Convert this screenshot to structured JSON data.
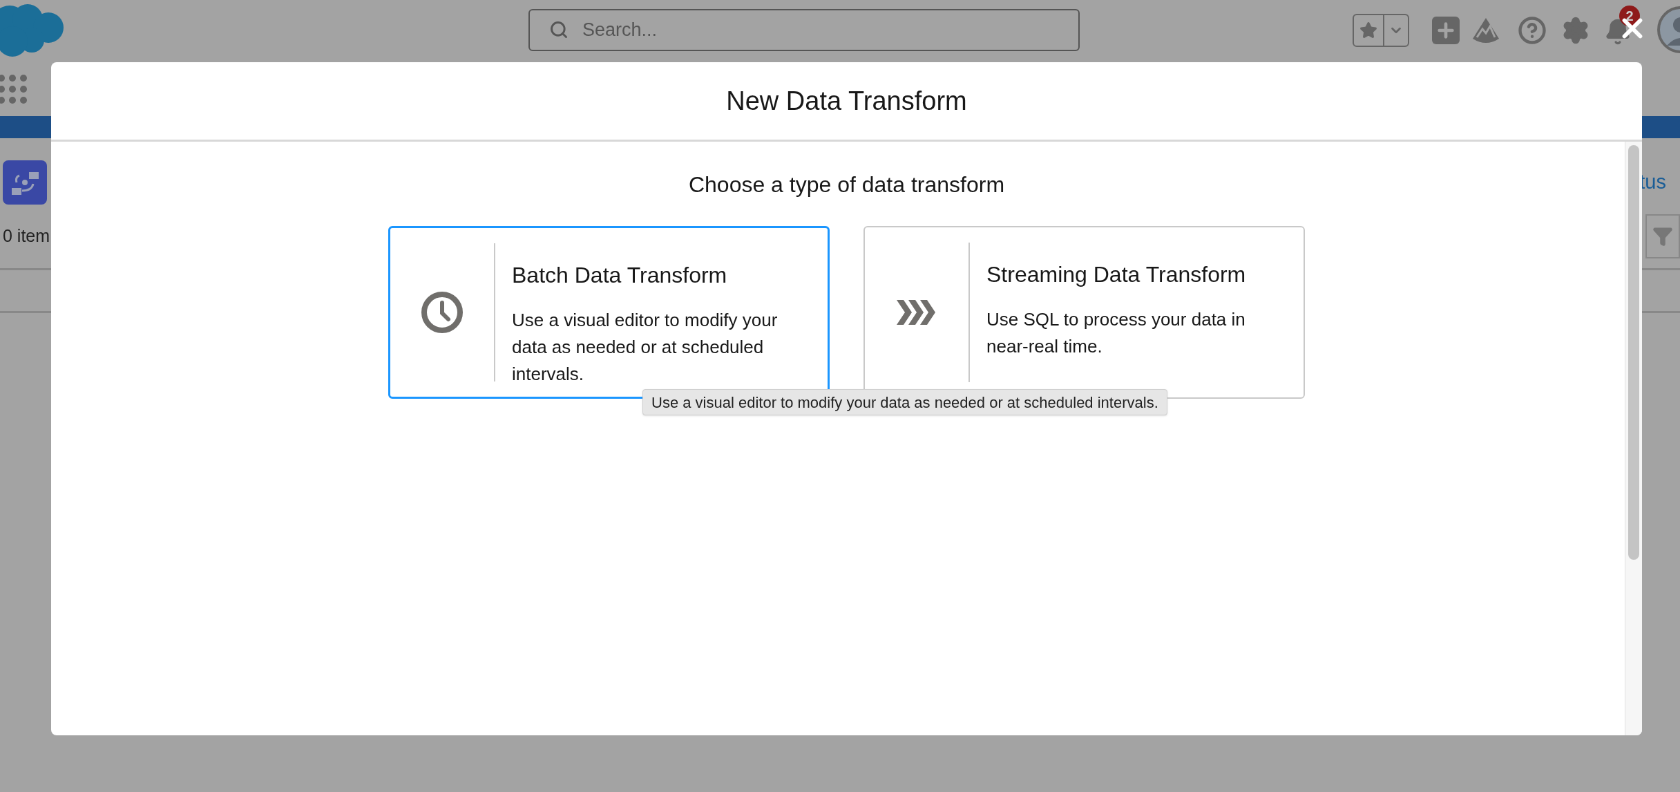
{
  "header": {
    "search": {
      "placeholder": "Search..."
    },
    "notification_count": "2"
  },
  "background": {
    "item_count": "0 item",
    "column_label": "tus"
  },
  "modal": {
    "title": "New Data Transform",
    "subtitle": "Choose a type of data transform",
    "options": [
      {
        "kind": "batch",
        "title": "Batch Data Transform",
        "description": "Use a visual editor to modify your data as needed or at scheduled intervals.",
        "selected": true
      },
      {
        "kind": "streaming",
        "title": "Streaming Data Transform",
        "description": "Use SQL to process your data in near-real time.",
        "selected": false
      }
    ],
    "tooltip": "Use a visual editor to modify your data as needed or at scheduled intervals."
  }
}
